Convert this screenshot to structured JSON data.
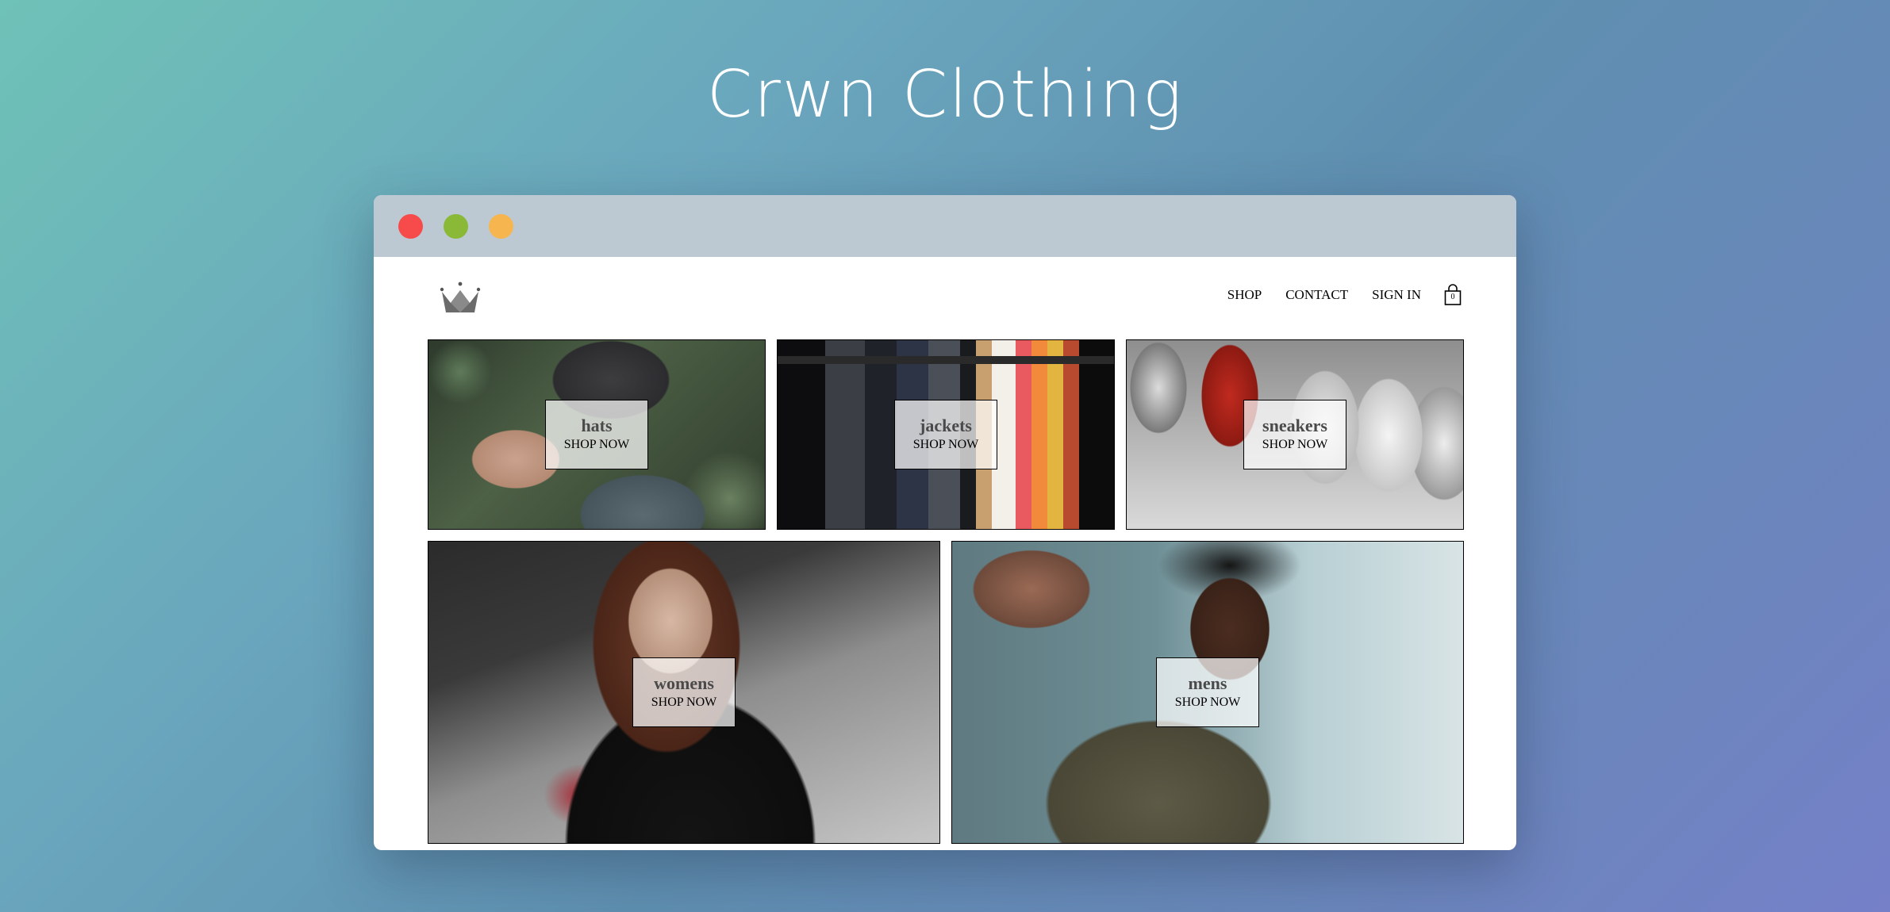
{
  "page": {
    "title": "Crwn Clothing"
  },
  "window": {
    "controls": [
      "close",
      "minimize",
      "maximize"
    ]
  },
  "nav": {
    "logo_icon": "crown-icon",
    "links": [
      "SHOP",
      "CONTACT",
      "SIGN IN"
    ],
    "cart_icon": "shopping-bag-icon",
    "cart_count": "0"
  },
  "directory": {
    "items": [
      {
        "title": "hats",
        "subtitle": "SHOP NOW"
      },
      {
        "title": "jackets",
        "subtitle": "SHOP NOW"
      },
      {
        "title": "sneakers",
        "subtitle": "SHOP NOW"
      },
      {
        "title": "womens",
        "subtitle": "SHOP NOW"
      },
      {
        "title": "mens",
        "subtitle": "SHOP NOW"
      }
    ]
  },
  "colors": {
    "close": "#f74a4a",
    "minimize": "#8ab837",
    "maximize": "#f7b54f",
    "titlebar": "#bcc9d2"
  }
}
